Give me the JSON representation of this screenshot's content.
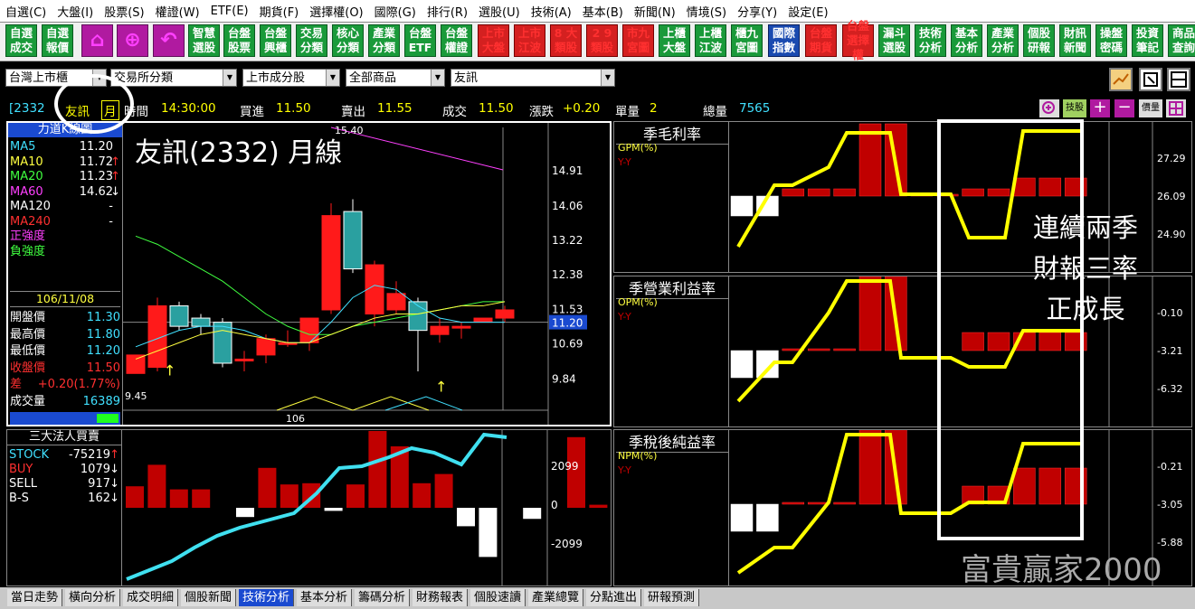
{
  "menu": [
    "自選(C)",
    "大盤(I)",
    "股票(S)",
    "權證(W)",
    "ETF(E)",
    "期貨(F)",
    "選擇權(O)",
    "國際(G)",
    "排行(R)",
    "選股(U)",
    "技術(A)",
    "基本(B)",
    "新聞(N)",
    "情境(S)",
    "分享(Y)",
    "設定(E)"
  ],
  "toolbar": [
    {
      "l1": "自選",
      "l2": "成交",
      "c": "grn"
    },
    {
      "l1": "自選",
      "l2": "報價",
      "c": "grn"
    },
    {
      "l1": "⌂",
      "l2": "",
      "c": "mag",
      "icon": "home-icon"
    },
    {
      "l1": "⊕",
      "l2": "",
      "c": "mag",
      "icon": "globe-icon"
    },
    {
      "l1": "↶",
      "l2": "",
      "c": "mag",
      "icon": "back-icon"
    },
    {
      "l1": "智慧",
      "l2": "選股",
      "c": "grn"
    },
    {
      "l1": "台盤",
      "l2": "股票",
      "c": "grn"
    },
    {
      "l1": "台盤",
      "l2": "興櫃",
      "c": "grn"
    },
    {
      "l1": "交易",
      "l2": "分類",
      "c": "grn"
    },
    {
      "l1": "核心",
      "l2": "分類",
      "c": "grn"
    },
    {
      "l1": "產業",
      "l2": "分類",
      "c": "grn"
    },
    {
      "l1": "台盤",
      "l2": "ETF",
      "c": "grn"
    },
    {
      "l1": "台盤",
      "l2": "權證",
      "c": "grn"
    },
    {
      "l1": "上市",
      "l2": "大盤",
      "c": "red"
    },
    {
      "l1": "上市",
      "l2": "江波",
      "c": "red"
    },
    {
      "l1": "8 大",
      "l2": "類股",
      "c": "red"
    },
    {
      "l1": "2 9",
      "l2": "類股",
      "c": "red"
    },
    {
      "l1": "市九",
      "l2": "宮圖",
      "c": "red"
    },
    {
      "l1": "上櫃",
      "l2": "大盤",
      "c": "grn"
    },
    {
      "l1": "上櫃",
      "l2": "江波",
      "c": "grn"
    },
    {
      "l1": "櫃九",
      "l2": "宮圖",
      "c": "grn"
    },
    {
      "l1": "國際",
      "l2": "指數",
      "c": "blu"
    },
    {
      "l1": "台盤",
      "l2": "期貨",
      "c": "red"
    },
    {
      "l1": "台盤",
      "l2": "選擇權",
      "c": "red"
    },
    {
      "l1": "漏斗",
      "l2": "選股",
      "c": "grn"
    },
    {
      "l1": "技術",
      "l2": "分析",
      "c": "grn"
    },
    {
      "l1": "基本",
      "l2": "分析",
      "c": "grn"
    },
    {
      "l1": "產業",
      "l2": "分析",
      "c": "grn"
    },
    {
      "l1": "個股",
      "l2": "研報",
      "c": "grn"
    },
    {
      "l1": "財訊",
      "l2": "新聞",
      "c": "grn"
    },
    {
      "l1": "操盤",
      "l2": "密碼",
      "c": "grn"
    },
    {
      "l1": "投資",
      "l2": "筆記",
      "c": "grn"
    },
    {
      "l1": "商品",
      "l2": "查詢",
      "c": "grn"
    }
  ],
  "combos": {
    "market": "台灣上市櫃",
    "exchange_cat": "交易所分類",
    "listed": "上市成分股",
    "all": "全部商品",
    "stock": "友訊"
  },
  "info": {
    "code": "[2332",
    "name": "友訊",
    "period": "月",
    "time_label": "時間",
    "time": "14:30:00",
    "bid_label": "買進",
    "bid": "11.50",
    "ask_label": "賣出",
    "ask": "11.55",
    "deal_label": "成交",
    "deal": "11.50",
    "chg_label": "漲跌",
    "chg": "+0.20",
    "vol_label": "單量",
    "vol": "2",
    "tvol_label": "總量",
    "tvol": "7565",
    "tech_btn": "技股",
    "price_btn": "價量"
  },
  "left_panel": {
    "title": "力道K線圖",
    "overlay": "友訊(2332) 月線",
    "mas": [
      {
        "name": "MA5",
        "val": "11.20",
        "color": "#40e0ff"
      },
      {
        "name": "MA10",
        "val": "11.72",
        "color": "#ffff40",
        "arrow": "↑"
      },
      {
        "name": "MA20",
        "val": "11.23",
        "color": "#40ff40",
        "arrow": "↑"
      },
      {
        "name": "MA60",
        "val": "14.62",
        "color": "#ff40ff",
        "arrow": "↓"
      },
      {
        "name": "MA120",
        "val": "-",
        "color": "#ffffff"
      },
      {
        "name": "MA240",
        "val": "-",
        "color": "#ff3030"
      },
      {
        "name": "正強度",
        "val": "",
        "color": "#ff40ff"
      },
      {
        "name": "負強度",
        "val": "",
        "color": "#40ff40"
      }
    ],
    "date": "106/11/08",
    "ohlc": [
      {
        "name": "開盤價",
        "val": "11.30",
        "nc": "#ffffff",
        "vc": "#40e0ff"
      },
      {
        "name": "最高價",
        "val": "11.80",
        "nc": "#ffffff",
        "vc": "#40e0ff"
      },
      {
        "name": "最低價",
        "val": "11.20",
        "nc": "#ffffff",
        "vc": "#40e0ff"
      },
      {
        "name": "收盤價",
        "val": "11.50",
        "nc": "#ff3030",
        "vc": "#ff3030"
      },
      {
        "name": "差",
        "val": "+0.20(1.77%)",
        "nc": "#ff3030",
        "vc": "#ff3030"
      },
      {
        "name": "成交量",
        "val": "16389",
        "nc": "#ffffff",
        "vc": "#40e0ff"
      }
    ],
    "ticks": [
      "14.91",
      "14.06",
      "13.22",
      "12.38",
      "11.53",
      "10.69",
      "9.84"
    ],
    "current": "11.20",
    "high_label": "15.40",
    "low_label": "9.45",
    "xlabel": "106"
  },
  "inst_panel": {
    "title": "三大法人買賣",
    "rows": [
      {
        "name": "STOCK",
        "val": "-75219",
        "arrow": "↑",
        "nc": "#40e0ff"
      },
      {
        "name": "BUY",
        "val": "1079",
        "arrow": "↓",
        "nc": "#ff3030"
      },
      {
        "name": "SELL",
        "val": "917",
        "arrow": "↓",
        "nc": "#ffffff"
      },
      {
        "name": "B-S",
        "val": "162",
        "arrow": "↓",
        "nc": "#ffffff"
      }
    ],
    "ticks": [
      "2099",
      "0",
      "-2099"
    ]
  },
  "fund_panels": [
    {
      "title": "季毛利率",
      "sub": "GPM(%)",
      "yy": "Y-Y",
      "ticks": [
        "27.29",
        "26.09",
        "24.90"
      ]
    },
    {
      "title": "季營業利益率",
      "sub": "OPM(%)",
      "yy": "Y-Y",
      "ticks": [
        "-0.10",
        "-3.21",
        "-6.32"
      ]
    },
    {
      "title": "季稅後純益率",
      "sub": "NPM(%)",
      "yy": "Y-Y",
      "ticks": [
        "-0.21",
        "-3.05",
        "-5.88"
      ]
    }
  ],
  "annotation": {
    "l1": "連續兩季",
    "l2": "財報三率",
    "l3": "正成長"
  },
  "watermark": "富貴贏家2000",
  "tabs": [
    "當日走勢",
    "橫向分析",
    "成交明細",
    "個股新聞",
    "技術分析",
    "基本分析",
    "籌碼分析",
    "財務報表",
    "個股速讀",
    "產業總覽",
    "分點進出",
    "研報預測"
  ],
  "active_tab": "技術分析"
}
